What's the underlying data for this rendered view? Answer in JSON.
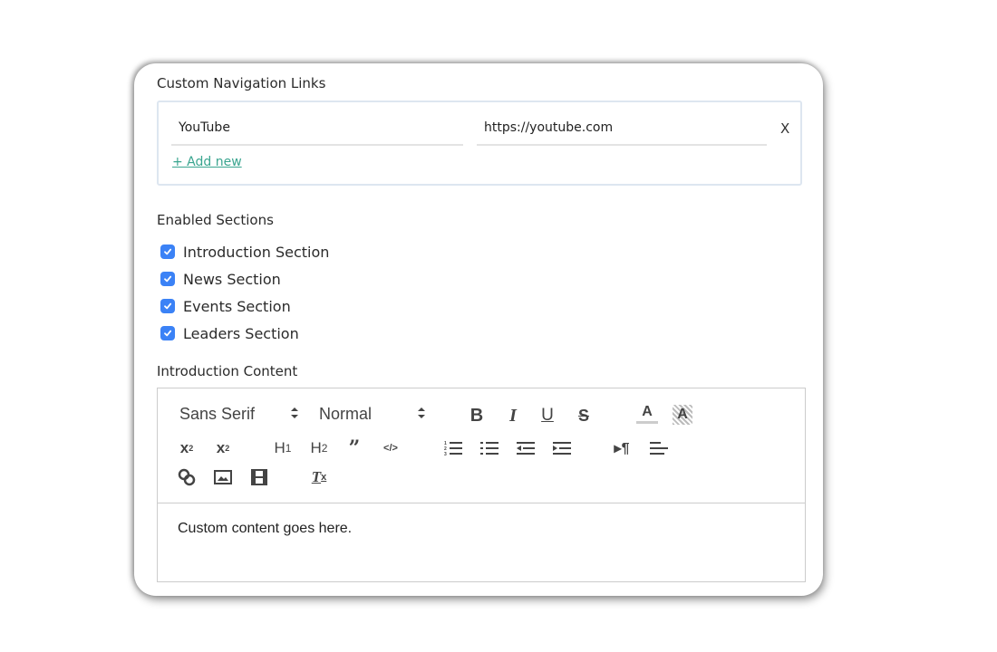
{
  "nav_links": {
    "label": "Custom Navigation Links",
    "items": [
      {
        "name": "YouTube",
        "url": "https://youtube.com",
        "remove": "X"
      }
    ],
    "add_new": "+ Add new"
  },
  "sections": {
    "label": "Enabled Sections",
    "items": [
      {
        "label": "Introduction Section",
        "checked": true
      },
      {
        "label": "News Section",
        "checked": true
      },
      {
        "label": "Events Section",
        "checked": true
      },
      {
        "label": "Leaders Section",
        "checked": true
      }
    ]
  },
  "intro": {
    "label": "Introduction Content",
    "toolbar": {
      "font": "Sans Serif",
      "size": "Normal",
      "buttons": [
        "bold-icon",
        "italic-icon",
        "underline-icon",
        "strike-icon",
        "text-color-icon",
        "background-color-icon",
        "subscript-icon",
        "superscript-icon",
        "header-1-icon",
        "header-2-icon",
        "blockquote-icon",
        "code-block-icon",
        "ordered-list-icon",
        "bullet-list-icon",
        "outdent-icon",
        "indent-icon",
        "rtl-icon",
        "align-icon",
        "link-icon",
        "image-icon",
        "video-icon",
        "clear-format-icon"
      ]
    },
    "content": "Custom content goes here."
  },
  "colors": {
    "accent": "#3aa58f",
    "checkbox": "#3b82f6"
  }
}
